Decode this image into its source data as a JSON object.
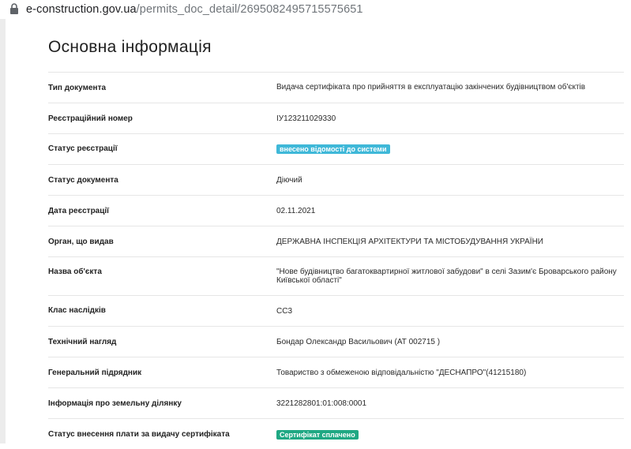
{
  "browser": {
    "url_domain": "e-construction.gov.ua",
    "url_path": "/permits_doc_detail/2695082495715575651"
  },
  "page": {
    "title": "Основна інформація"
  },
  "rows": [
    {
      "label": "Тип документа",
      "value": "Видача сертифіката про прийняття в експлуатацію закінчених будівництвом об'єктів"
    },
    {
      "label": "Реєстраційний номер",
      "value": "ІУ123211029330"
    },
    {
      "label": "Статус реєстрації",
      "value": "внесено відомості до системи",
      "badge_color": "#3fb8d8"
    },
    {
      "label": "Статус документа",
      "value": "Діючий"
    },
    {
      "label": "Дата реєстрації",
      "value": "02.11.2021"
    },
    {
      "label": "Орган, що видав",
      "value": "ДЕРЖАВНА ІНСПЕКЦІЯ АРХІТЕКТУРИ ТА МІСТОБУДУВАННЯ УКРАЇНИ"
    },
    {
      "label": "Назва об'єкта",
      "value": "\"Нове будівництво багатоквартирної житлової забудови\" в селі Зазим'є Броварського району Київської області\""
    },
    {
      "label": "Клас наслідків",
      "value": "СС3"
    },
    {
      "label": "Технічний нагляд",
      "value": "Бондар Олександр Васильович (АТ 002715 )"
    },
    {
      "label": "Генеральний підрядник",
      "value": "Товариство з обмеженою відповідальністю \"ДЕСНАПРО\"(41215180)"
    },
    {
      "label": "Інформація про земельну ділянку",
      "value": "3221282801:01:008:0001"
    },
    {
      "label": "Статус внесення плати за видачу сертифіката",
      "value": "Сертифікат сплачено",
      "badge_color": "#1fa883"
    }
  ]
}
